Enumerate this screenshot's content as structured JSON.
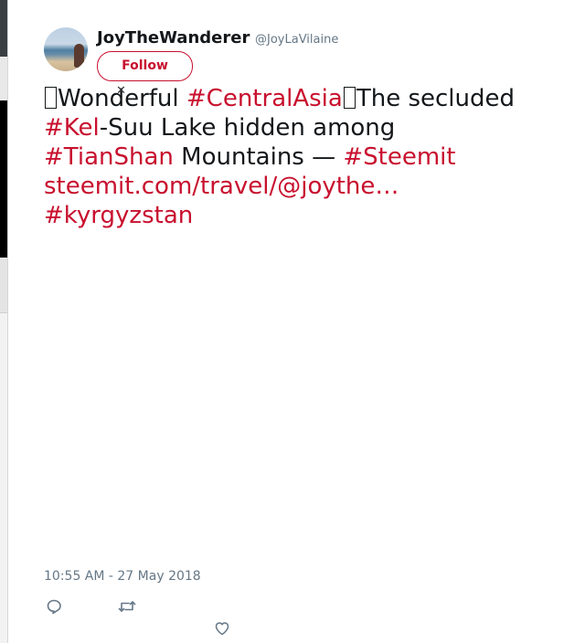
{
  "author": {
    "name": "JoyTheWanderer",
    "handle": "@JoyLaVilaine",
    "follow_label": "Follow"
  },
  "tweet": {
    "line1": {
      "pre": "Wonderful ",
      "tag": "#CentralAsia",
      "post": "The secluded"
    },
    "line2": {
      "tag": "#Kel",
      "post": "-Suu Lake hidden among"
    },
    "line3": {
      "tag1": "#TianShan",
      "mid": " Mountains — ",
      "tag2": "#Steemit"
    },
    "line4": {
      "link": "steemit.com/travel/@joythe…"
    },
    "line5": {
      "tag": "#kyrgyzstan"
    }
  },
  "timestamp": "10:55 AM - 27 May 2018",
  "actions": {
    "reply_icon": "reply-icon",
    "retweet_icon": "retweet-icon",
    "like_icon": "heart-icon"
  },
  "colors": {
    "link": "#c8102e",
    "text": "#14171a",
    "muted": "#657786"
  }
}
